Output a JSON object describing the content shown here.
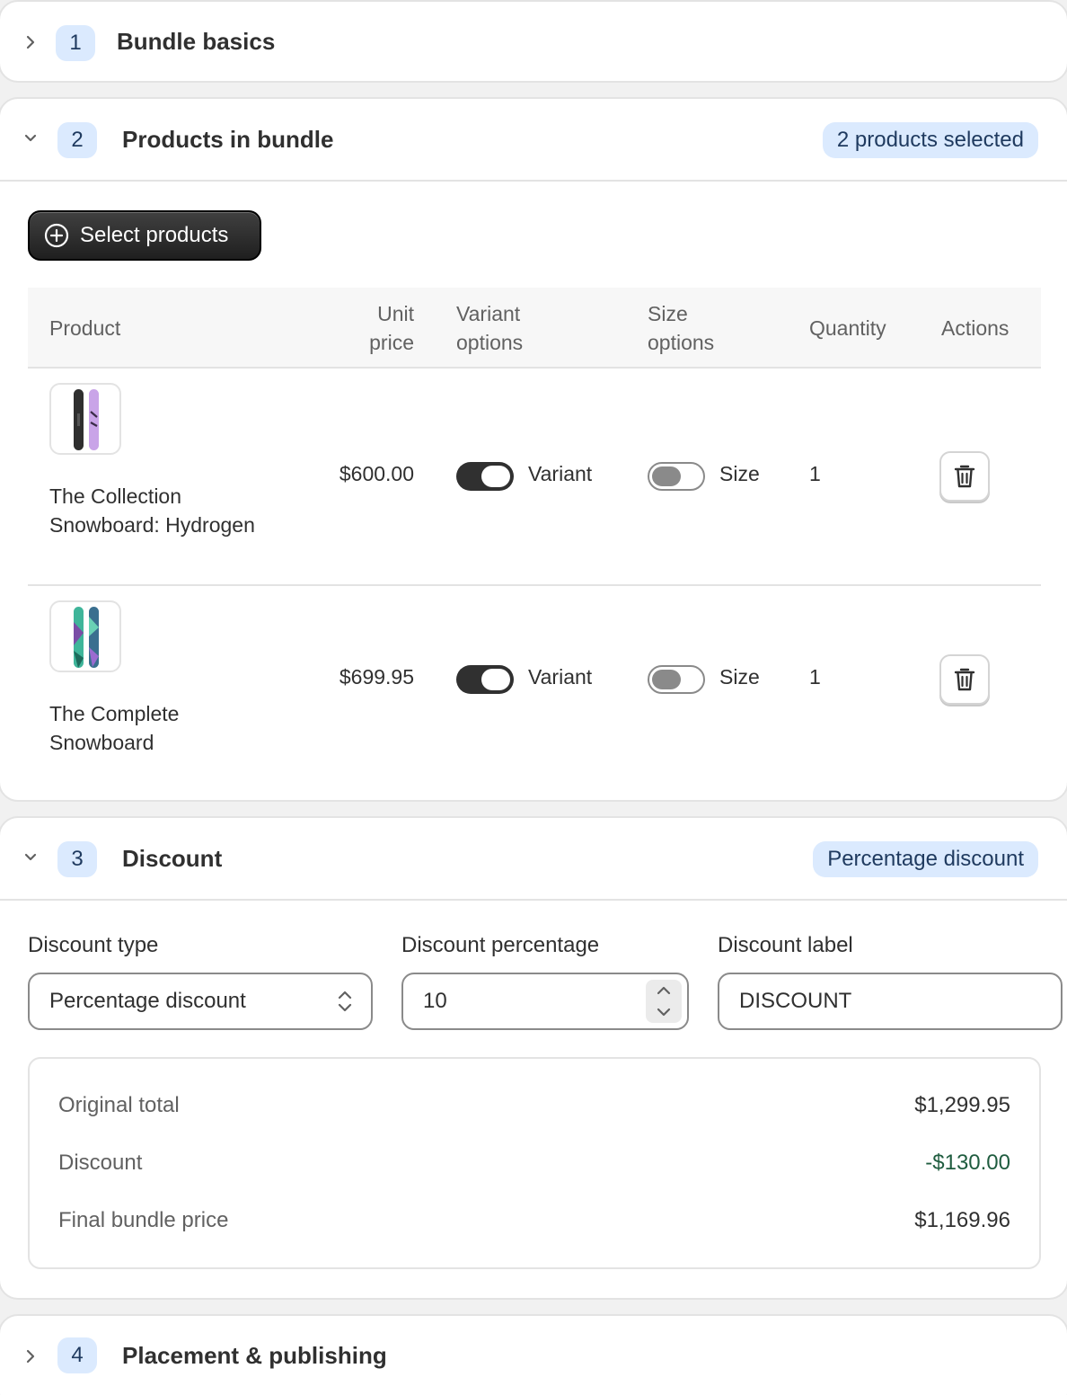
{
  "sections": {
    "basics": {
      "step": "1",
      "title": "Bundle basics"
    },
    "products": {
      "step": "2",
      "title": "Products in bundle",
      "badge": "2 products selected",
      "select_button": "Select products",
      "columns": {
        "product": "Product",
        "unit_price": "Unit price",
        "variant_options": "Variant options",
        "size_options": "Size options",
        "quantity": "Quantity",
        "actions": "Actions"
      },
      "rows": [
        {
          "name": "The Collection Snowboard: Hydrogen",
          "price": "$600.00",
          "variant_label": "Variant",
          "variant_on": true,
          "size_label": "Size",
          "size_on": false,
          "quantity": "1"
        },
        {
          "name": "The Complete Snowboard",
          "price": "$699.95",
          "variant_label": "Variant",
          "variant_on": true,
          "size_label": "Size",
          "size_on": false,
          "quantity": "1"
        }
      ]
    },
    "discount": {
      "step": "3",
      "title": "Discount",
      "badge": "Percentage discount",
      "type_label": "Discount type",
      "type_value": "Percentage discount",
      "percentage_label": "Discount percentage",
      "percentage_value": "10",
      "label_label": "Discount label",
      "label_value": "DISCOUNT",
      "summary": {
        "original_label": "Original total",
        "original_value": "$1,299.95",
        "discount_label": "Discount",
        "discount_value": "-$130.00",
        "final_label": "Final bundle price",
        "final_value": "$1,169.96"
      }
    },
    "placement": {
      "step": "4",
      "title": "Placement & publishing"
    }
  },
  "colors": {
    "accent_badge_bg": "#dbeafe",
    "accent_badge_text": "#1f3a5f",
    "discount_green": "#1f5c3f",
    "primary_button": "#303030"
  },
  "icons": {
    "collapsed": "chevron-right-icon",
    "expanded": "chevron-down-icon",
    "add": "plus-circle-icon",
    "delete": "trash-icon",
    "select": "select-arrows-icon",
    "stepper": "chevron-up-down-icon"
  }
}
